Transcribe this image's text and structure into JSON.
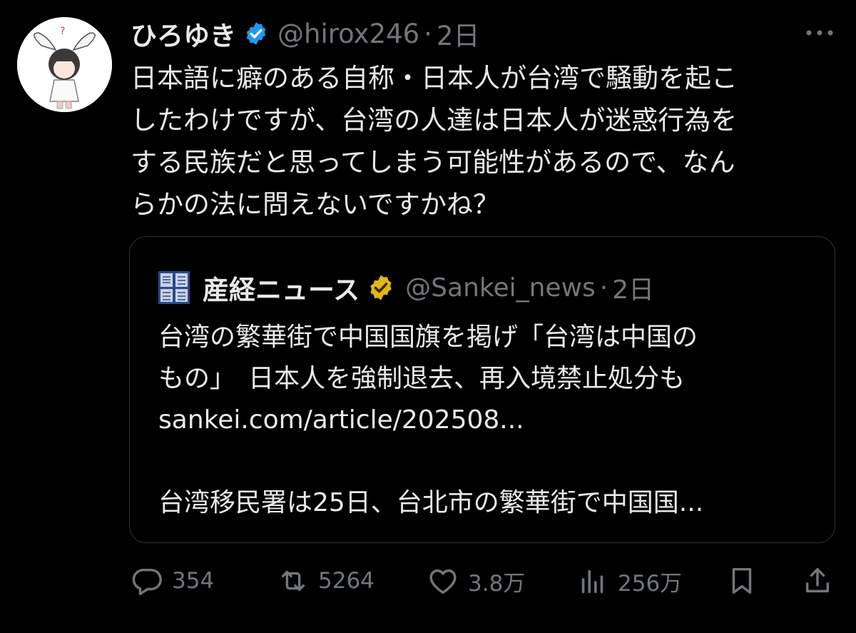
{
  "tweet": {
    "author_name": "ひろゆき",
    "author_handle": "@hirox246",
    "separator": "·",
    "time": "2日",
    "text": "日本語に癖のある自称・日本人が台湾で騒動を起こ\nしたわけですが、台湾の人達は日本人が迷惑行為を\nする民族だと思ってしまう可能性があるので、なん\nらかの法に問えないですかね？",
    "verified_color": "#1d9bf0"
  },
  "quote": {
    "author_name": "産経ニュース",
    "author_handle": "@Sankei_news",
    "separator": "·",
    "time": "2日",
    "text": "台湾の繁華街で中国国旗を掲げ「台湾は中国の\nもの」　日本人を強制退去、再入境禁止処分も\nsankei.com/article/202508...\n\n台湾移民署は25日、台北市の繁華街で中国国...",
    "verified_color": "#e2b719"
  },
  "actions": {
    "reply_count": "354",
    "retweet_count": "5264",
    "like_count": "3.8万",
    "views_count": "256万"
  },
  "icons": {
    "more": "more-icon",
    "reply": "reply-icon",
    "retweet": "retweet-icon",
    "like": "heart-icon",
    "views": "views-icon",
    "bookmark": "bookmark-icon",
    "share": "share-icon"
  }
}
